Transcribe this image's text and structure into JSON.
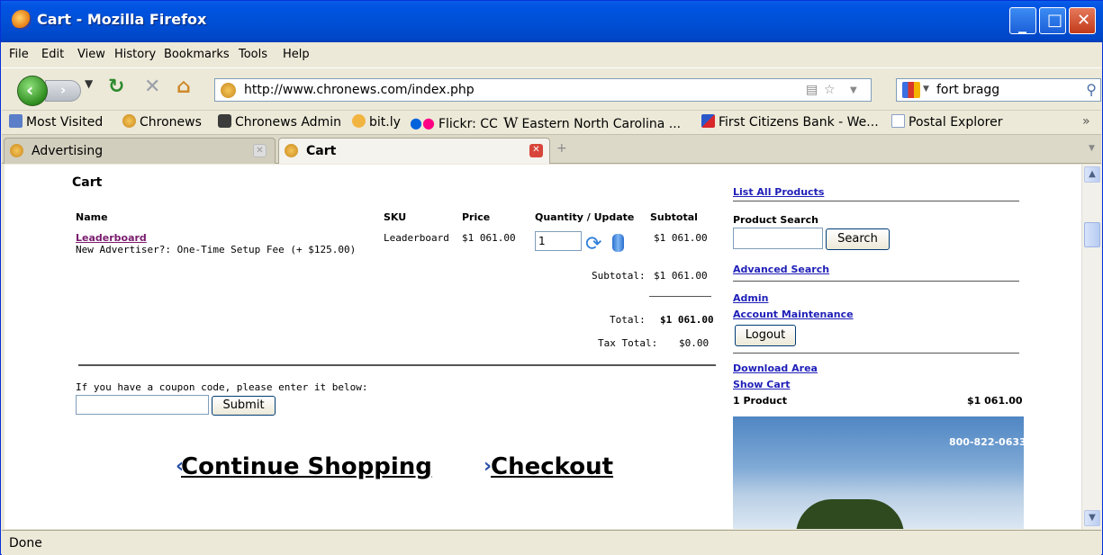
{
  "window": {
    "title": "Cart - Mozilla Firefox"
  },
  "menu": [
    "File",
    "Edit",
    "View",
    "History",
    "Bookmarks",
    "Tools",
    "Help"
  ],
  "url": "http://www.chronews.com/index.php",
  "search_query": "fort bragg",
  "bookmarks": [
    "Most Visited",
    "Chronews",
    "Chronews Admin",
    "bit.ly",
    "Flickr: CC",
    "Eastern North Carolina ...",
    "First Citizens Bank - We...",
    "Postal Explorer"
  ],
  "bookmarks_more": "»",
  "tabs": [
    {
      "label": "Advertising",
      "active": false
    },
    {
      "label": "Cart",
      "active": true
    }
  ],
  "new_tab": "+",
  "page": {
    "heading": "Cart",
    "columns": {
      "name": "Name",
      "sku": "SKU",
      "price": "Price",
      "quantity": "Quantity / Update",
      "subtotal": "Subtotal"
    },
    "item": {
      "name": "Leaderboard",
      "option": "New Advertiser?: One-Time Setup Fee (+ $125.00)",
      "sku": "Leaderboard",
      "price": "$1 061.00",
      "quantity": "1",
      "subtotal": "$1 061.00"
    },
    "totals": {
      "subtotal_label": "Subtotal:",
      "subtotal_value": "$1 061.00",
      "total_label": "Total:",
      "total_value": "$1 061.00",
      "tax_label": "Tax Total:",
      "tax_value": "$0.00"
    },
    "coupon_prompt": "If you have a coupon code, please enter it below:",
    "coupon_value": "",
    "submit_label": "Submit",
    "continue_label": "Continue Shopping",
    "checkout_label": "Checkout"
  },
  "sidebar": {
    "list_all": "List All Products",
    "product_search_label": "Product Search",
    "search_value": "",
    "search_button": "Search",
    "advanced_search": "Advanced Search",
    "admin": "Admin",
    "account": "Account Maintenance",
    "logout": "Logout",
    "download": "Download Area",
    "show_cart": "Show Cart",
    "cart_count": "1 Product",
    "cart_total": "$1 061.00",
    "banner_phone": "800-822-0633"
  },
  "status": "Done",
  "colors": {
    "link": "#1f1fb8",
    "visited": "#7a1c6e",
    "titlebar": "#0054E3"
  }
}
